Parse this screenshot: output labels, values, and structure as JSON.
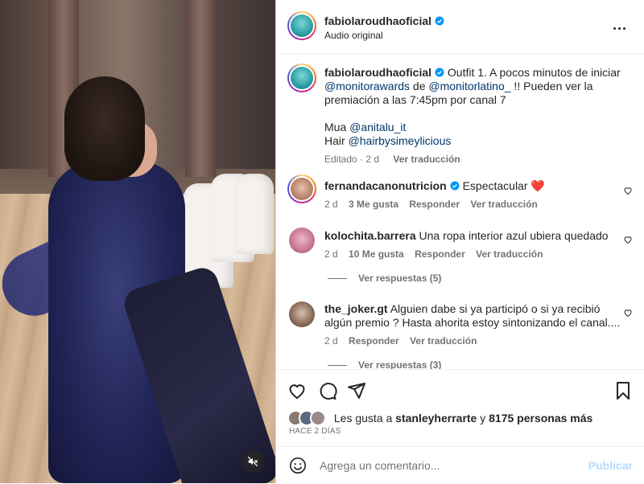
{
  "header": {
    "username": "fabiolaroudhaoficial",
    "subtitle": "Audio original",
    "more_icon": "more-horizontal-icon"
  },
  "caption": {
    "username": "fabiolaroudhaoficial",
    "text1": "Outfit 1. A pocos minutos de iniciar",
    "mention1": "@monitorawards",
    "de": " de ",
    "mention2": "@monitorlatino_",
    "text2": " !! Pueden ver la premiación a las 7:45pm por canal 7",
    "mua_label": "Mua ",
    "mua_mention": "@anitalu_it",
    "hair_label": "Hair ",
    "hair_mention": "@hairbysimeylicious",
    "edited": "Editado · 2 d",
    "translate": "Ver traducción"
  },
  "comments": [
    {
      "username": "fernandacanonutricion",
      "text": "Espectacular ❤️",
      "age": "2 d",
      "likes": "3 Me gusta",
      "reply": "Responder",
      "translate": "Ver traducción"
    },
    {
      "username": "kolochita.barrera",
      "text": "Una ropa interior azul ubiera quedado",
      "age": "2 d",
      "likes": "10 Me gusta",
      "reply": "Responder",
      "translate": "Ver traducción",
      "view_replies": "Ver respuestas (5)"
    },
    {
      "username": "the_joker.gt",
      "text1": "Alguien dabe si ya participó o si ya recibió",
      "text2": "algún premio ? Hasta ahorita estoy sintonizando el canal....",
      "age": "2 d",
      "reply": "Responder",
      "translate": "Ver traducción",
      "view_replies": "Ver respuestas (3)"
    }
  ],
  "likes": {
    "prefix": "Les gusta a ",
    "user": "stanleyherrarte",
    "conj": " y ",
    "others": "8175 personas más"
  },
  "ago": "HACE 2 DÍAS",
  "compose": {
    "placeholder": "Agrega un comentario...",
    "post": "Publicar"
  },
  "colors": {
    "verified": "#0095f6",
    "heart_red": "#ed4956",
    "link": "#00376b",
    "post_disabled": "#b3dbff"
  }
}
